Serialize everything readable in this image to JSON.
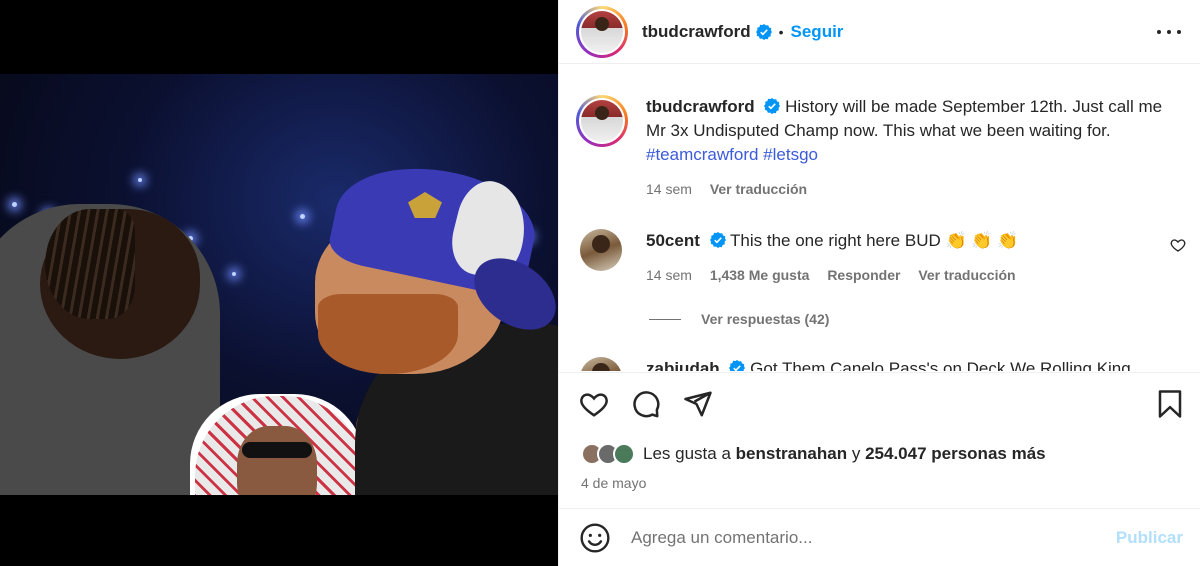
{
  "post": {
    "username": "tbudcrawford",
    "follow_label": "Seguir",
    "separator": "•"
  },
  "caption": {
    "username": "tbudcrawford",
    "text": "History will be made September 12th. Just call me Mr 3x Undisputed Champ now. This what we been waiting for.",
    "hashtag1": "#teamcrawford",
    "hashtag2": "#letsgo",
    "time": "14 sem",
    "translate": "Ver traducción"
  },
  "comments": [
    {
      "username": "50cent",
      "text": "This the one right here BUD 👏 👏 👏",
      "time": "14 sem",
      "likes": "1,438 Me gusta",
      "reply": "Responder",
      "translate": "Ver traducción",
      "view_replies": "Ver respuestas (42)"
    },
    {
      "username": "zabjudah",
      "text": "Got Them Canelo Pass's on Deck We Rolling King"
    }
  ],
  "likes": {
    "prefix": "Les gusta a",
    "user": "benstranahan",
    "joiner": "y",
    "rest": "254.047 personas más"
  },
  "date": "4 de mayo",
  "comment_box": {
    "placeholder": "Agrega un comentario...",
    "publish_label": "Publicar"
  },
  "colors": {
    "link_blue": "#0095f6",
    "hashtag": "#3b5bdb",
    "muted": "#737373",
    "publish_disabled": "#b2dffc"
  }
}
